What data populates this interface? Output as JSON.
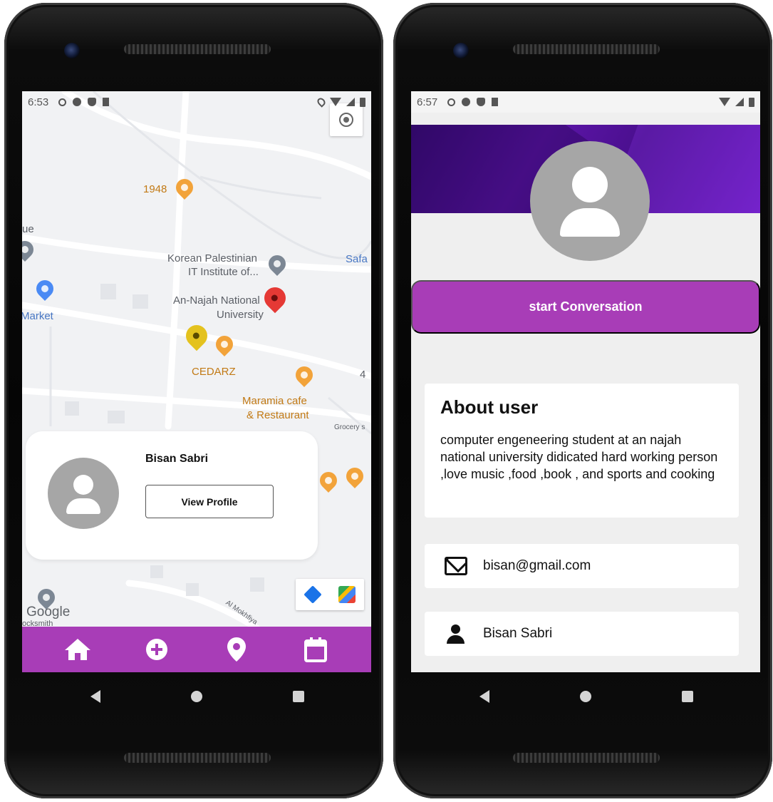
{
  "left_phone": {
    "status_bar": {
      "time": "6:53"
    },
    "map": {
      "labels": {
        "place_1948": "1948",
        "korean_line1": "Korean Palestinian",
        "korean_line2": "IT Institute of...",
        "safa": "Safa",
        "najah_line1": "An-Najah National",
        "najah_line2": "University",
        "market": "Market",
        "ue": "ue",
        "cedarz": "CEDARZ",
        "maramia_line1": "Maramia cafe",
        "maramia_line2": "& Restaurant",
        "grocery": "Grocery s",
        "road_num": "4",
        "street": "Al Mokhfiya",
        "google": "Google",
        "locksmith": "ocksmith"
      }
    },
    "profile_card": {
      "name": "Bisan Sabri",
      "view_profile_label": "View Profile"
    },
    "bottom_nav": {
      "items": [
        "home-icon",
        "add-circle-icon",
        "location-pin-icon",
        "calendar-icon"
      ]
    }
  },
  "right_phone": {
    "status_bar": {
      "time": "6:57"
    },
    "start_button_label": "start Conversation",
    "about": {
      "title": "About user",
      "text": "computer engeneering student at an najah national university didicated hard working person ,love music ,food ,book , and sports and cooking"
    },
    "email": "bisan@gmail.com",
    "name": "Bisan Sabri"
  },
  "colors": {
    "accent": "#a83db7",
    "banner": "#5c15a8"
  }
}
